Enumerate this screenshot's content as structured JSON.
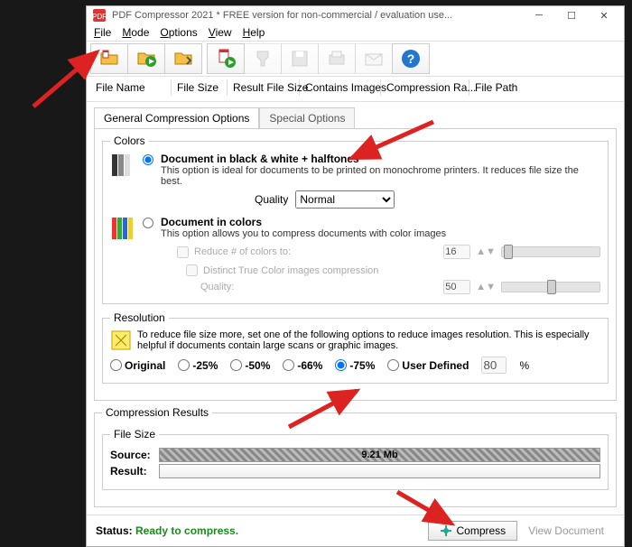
{
  "window": {
    "title": "PDF Compressor 2021  * FREE version for non-commercial / evaluation use..."
  },
  "menu": {
    "file": "File",
    "mode": "Mode",
    "options": "Options",
    "view": "View",
    "help": "Help"
  },
  "headers": [
    "File Name",
    "File Size",
    "Result File Size",
    "Contains Images",
    "Compression Ra...",
    "File Path"
  ],
  "tabs": {
    "general": "General Compression Options",
    "special": "Special Options"
  },
  "colors": {
    "legend": "Colors",
    "bw": {
      "title": "Document in black & white + halftones",
      "desc": "This option is ideal for documents to be printed on monochrome printers. It reduces file size the best.",
      "quality_label": "Quality",
      "quality_value": "Normal"
    },
    "color": {
      "title": "Document in colors",
      "desc": "This option allows you to compress documents with color images",
      "reduce_label": "Reduce # of colors to:",
      "reduce_value": "16",
      "distinct_label": "Distinct True Color images compression",
      "quality_label": "Quality:",
      "quality_value": "50"
    }
  },
  "resolution": {
    "legend": "Resolution",
    "desc": "To reduce file size more, set one of the following options to reduce images resolution. This is especially helpful if documents contain large scans or graphic images.",
    "options": [
      "Original",
      "-25%",
      "-50%",
      "-66%",
      "-75%",
      "User Defined"
    ],
    "selected": "-75%",
    "user_value": "80",
    "user_suffix": "%"
  },
  "results": {
    "legend": "Compression Results",
    "filesize_legend": "File Size",
    "source_label": "Source:",
    "source_value": "9.21 Mb",
    "result_label": "Result:"
  },
  "status": {
    "label": "Status:",
    "value": "Ready to compress.",
    "compress_btn": "Compress",
    "view_btn": "View Document"
  }
}
